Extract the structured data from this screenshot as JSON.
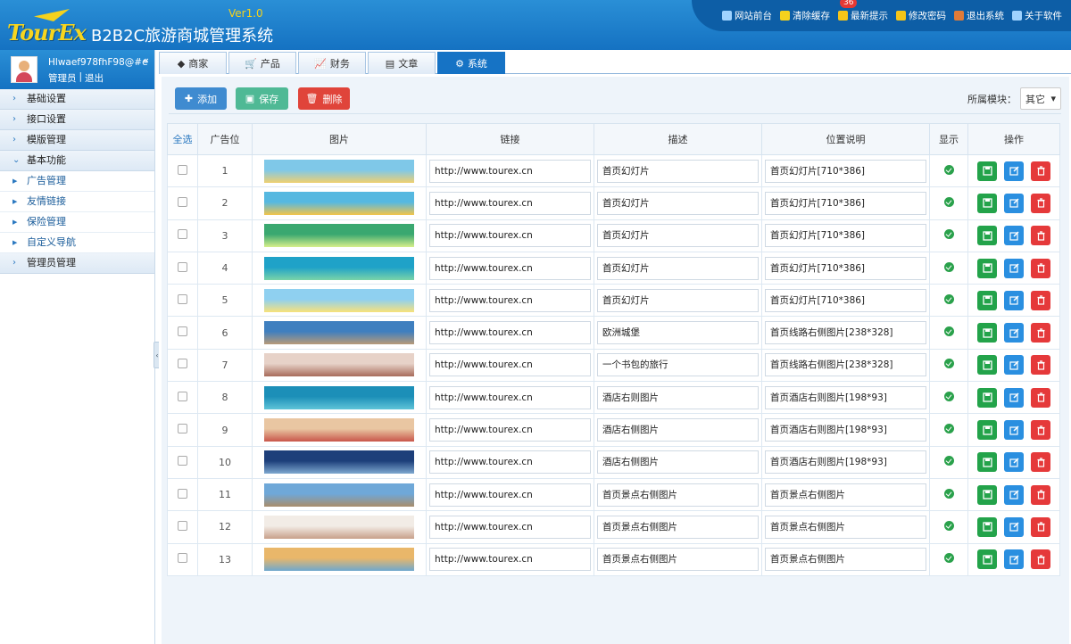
{
  "header": {
    "logo_text": "TourEx",
    "version": "Ver1.0",
    "title": "B2B2C旅游商城管理系统",
    "links": [
      {
        "label": "网站前台",
        "icon": "monitor-icon",
        "color": "#9fd3ff"
      },
      {
        "label": "清除缓存",
        "icon": "refresh-icon",
        "color": "#f5d21d"
      },
      {
        "label": "最新提示",
        "icon": "bell-icon",
        "color": "#f5c518",
        "badge": "36"
      },
      {
        "label": "修改密码",
        "icon": "lock-icon",
        "color": "#f5c518"
      },
      {
        "label": "退出系统",
        "icon": "exit-icon",
        "color": "#e07b39"
      },
      {
        "label": "关于软件",
        "icon": "info-icon",
        "color": "#9fd3ff"
      }
    ]
  },
  "user": {
    "name": "Hlwaef978fhF98@#e",
    "role": "管理员",
    "separator": "|",
    "logout": "退出"
  },
  "sidebar": {
    "items": [
      {
        "label": "基础设置",
        "type": "group",
        "expanded": false
      },
      {
        "label": "接口设置",
        "type": "group",
        "expanded": false
      },
      {
        "label": "模版管理",
        "type": "group",
        "expanded": false
      },
      {
        "label": "基本功能",
        "type": "group",
        "expanded": true
      },
      {
        "label": "广告管理",
        "type": "item"
      },
      {
        "label": "友情链接",
        "type": "item"
      },
      {
        "label": "保险管理",
        "type": "item"
      },
      {
        "label": "自定义导航",
        "type": "item"
      },
      {
        "label": "管理员管理",
        "type": "group",
        "expanded": false
      }
    ]
  },
  "tabs": [
    {
      "label": "商家",
      "icon": "tag-icon",
      "active": false
    },
    {
      "label": "产品",
      "icon": "cart-icon",
      "active": false
    },
    {
      "label": "财务",
      "icon": "chart-icon",
      "active": false
    },
    {
      "label": "文章",
      "icon": "article-icon",
      "active": false
    },
    {
      "label": "系统",
      "icon": "gear-icon",
      "active": true
    }
  ],
  "toolbar": {
    "add_label": "添加",
    "save_label": "保存",
    "delete_label": "删除",
    "module_label": "所属模块：",
    "module_value": "其它"
  },
  "table": {
    "headers": [
      "全选",
      "广告位",
      "图片",
      "链接",
      "描述",
      "位置说明",
      "显示",
      "操作"
    ],
    "rows": [
      {
        "pos": "1",
        "link": "http://www.tourex.cn",
        "desc": "首页幻灯片",
        "location": "首页幻灯片[710*386]",
        "c1": "#7fc8e8",
        "c2": "#f0d070"
      },
      {
        "pos": "2",
        "link": "http://www.tourex.cn",
        "desc": "首页幻灯片",
        "location": "首页幻灯片[710*386]",
        "c1": "#56b8e0",
        "c2": "#f3c44a"
      },
      {
        "pos": "3",
        "link": "http://www.tourex.cn",
        "desc": "首页幻灯片",
        "location": "首页幻灯片[710*386]",
        "c1": "#3aa870",
        "c2": "#d8ef8a"
      },
      {
        "pos": "4",
        "link": "http://www.tourex.cn",
        "desc": "首页幻灯片",
        "location": "首页幻灯片[710*386]",
        "c1": "#1fa2c8",
        "c2": "#7ad4a8"
      },
      {
        "pos": "5",
        "link": "http://www.tourex.cn",
        "desc": "首页幻灯片",
        "location": "首页幻灯片[710*386]",
        "c1": "#8fd0f0",
        "c2": "#f8e27a"
      },
      {
        "pos": "6",
        "link": "http://www.tourex.cn",
        "desc": "欧洲城堡",
        "location": "首页线路右侧图片[238*328]",
        "c1": "#3f7fbf",
        "c2": "#b89a78"
      },
      {
        "pos": "7",
        "link": "http://www.tourex.cn",
        "desc": "一个书包的旅行",
        "location": "首页线路右侧图片[238*328]",
        "c1": "#e7d2c8",
        "c2": "#a86b5a"
      },
      {
        "pos": "8",
        "link": "http://www.tourex.cn",
        "desc": "酒店右则图片",
        "location": "首页酒店右则图片[198*93]",
        "c1": "#1c8fb8",
        "c2": "#5fc4d8"
      },
      {
        "pos": "9",
        "link": "http://www.tourex.cn",
        "desc": "酒店右侧图片",
        "location": "首页酒店右则图片[198*93]",
        "c1": "#e9c6a2",
        "c2": "#c8564a"
      },
      {
        "pos": "10",
        "link": "http://www.tourex.cn",
        "desc": "酒店右侧图片",
        "location": "首页酒店右则图片[198*93]",
        "c1": "#1d3f7a",
        "c2": "#7ea8d0"
      },
      {
        "pos": "11",
        "link": "http://www.tourex.cn",
        "desc": "首页景点右侧图片",
        "location": "首页景点右侧图片",
        "c1": "#6fa8d8",
        "c2": "#a98c6a"
      },
      {
        "pos": "12",
        "link": "http://www.tourex.cn",
        "desc": "首页景点右侧图片",
        "location": "首页景点右侧图片",
        "c1": "#f2ece6",
        "c2": "#c7a08a"
      },
      {
        "pos": "13",
        "link": "http://www.tourex.cn",
        "desc": "首页景点右侧图片",
        "location": "首页景点右侧图片",
        "c1": "#e9b76a",
        "c2": "#6fa9cf"
      }
    ]
  }
}
